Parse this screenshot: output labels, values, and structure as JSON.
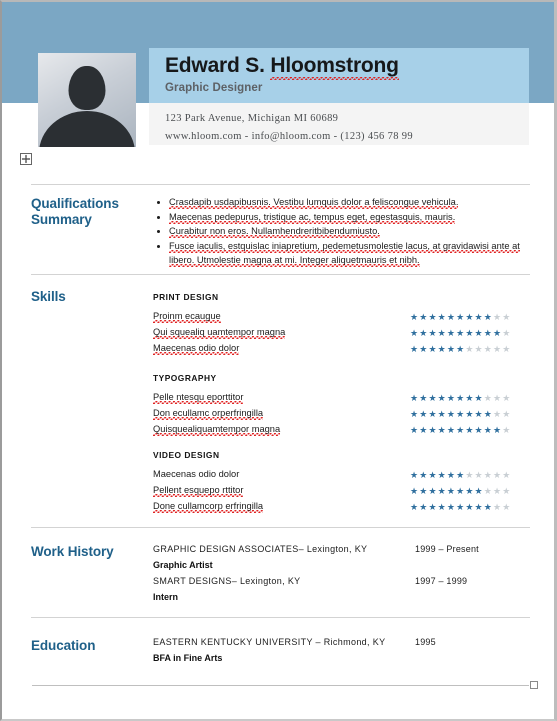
{
  "header": {
    "name": "Edward S. Hloomstrong",
    "name_plain": "Edward S. ",
    "name_misspelled": "Hloomstrong",
    "job_title": "Graphic Designer",
    "address": "123 Park Avenue, Michigan MI 60689",
    "contact_line": "www.hloom.com - info@hloom.com - (123) 456 78 99",
    "photo_alt": "person-silhouette-placeholder"
  },
  "colors": {
    "header_band": "#7ba7c4",
    "name_panel": "#a7d0e8",
    "contact_band": "#f4f4f4",
    "section_heading": "#1f6089",
    "star_filled": "#2f6f9e",
    "star_empty": "#c9cfd4",
    "spell_error": "#e02020",
    "rule": "#d3d3d3"
  },
  "sections": {
    "qualifications": {
      "title_line1": "Qualifications",
      "title_line2": "Summary",
      "bullets": [
        "Crasdapib usdapibusnis. Vestibu lumquis dolor a feliscongue vehicula.",
        "Maecenas pedepurus, tristique ac, tempus eget, egestasquis, mauris.",
        "Curabitur non eros. Nullamhendreritbibendumiusto.",
        "Fusce iaculis, estquislac iniapretium, pedemetusmolestie lacus, at gravidawisi ante at libero. Utmolestie magna at mi. Integer aliquetmauris et nibh."
      ]
    },
    "skills": {
      "title": "Skills",
      "max_stars": 11,
      "groups": [
        {
          "heading": "PRINT DESIGN",
          "items": [
            {
              "label": "Proinm ecaugue",
              "rating": 9
            },
            {
              "label": "Qui squealiq uamtempor magna",
              "rating": 10
            },
            {
              "label": "Maecenas odio dolor",
              "rating": 6
            }
          ]
        },
        {
          "heading": "TYPOGRAPHY",
          "items": [
            {
              "label": "Pelle ntesqu eporttitor",
              "rating": 8
            },
            {
              "label": "Don ecullamc orperfringilla",
              "rating": 9
            },
            {
              "label": "Quisquealiquamtempor magna",
              "rating": 10
            }
          ]
        },
        {
          "heading": "VIDEO DESIGN",
          "items": [
            {
              "label": "Maecenas odio dolor",
              "rating": 6
            },
            {
              "label": "Pellent esquepo rttitor",
              "rating": 8
            },
            {
              "label": "Done cullamcorp erfringilla",
              "rating": 9
            }
          ]
        }
      ]
    },
    "work_history": {
      "title": "Work History",
      "entries": [
        {
          "organization": "GRAPHIC DESIGN ASSOCIATES– Lexington, KY",
          "role": "Graphic Artist",
          "dates": "1999 – Present"
        },
        {
          "organization": "SMART DESIGNS– Lexington, KY",
          "role": "Intern",
          "dates": "1997 – 1999"
        }
      ]
    },
    "education": {
      "title": "Education",
      "entries": [
        {
          "organization": "EASTERN KENTUCKY UNIVERSITY – Richmond, KY",
          "role": "BFA in Fine Arts",
          "dates": "1995"
        }
      ]
    }
  },
  "controls": {
    "move_handle": "move-icon",
    "resize_handle": "resize-handle-icon"
  }
}
